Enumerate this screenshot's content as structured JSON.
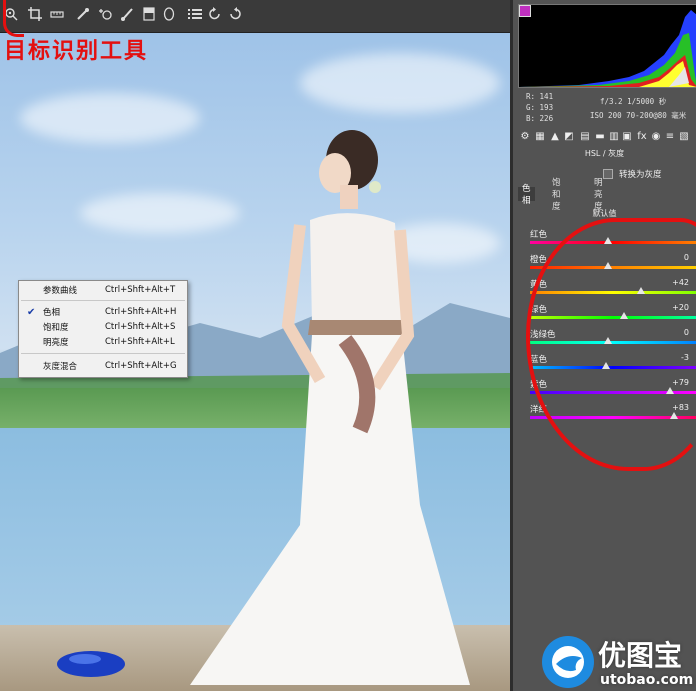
{
  "toolbar": {
    "tools": [
      "target-adjust-icon",
      "crop-icon",
      "straighten-icon",
      "spot-removal-icon",
      "red-eye-icon",
      "brush-icon",
      "graduated-filter-icon",
      "radial-filter-icon",
      "list-icon",
      "rotate-ccw-icon",
      "rotate-cw-icon"
    ]
  },
  "annotation": {
    "title": "目标识别工具"
  },
  "context_menu": {
    "items": [
      {
        "label": "参数曲线",
        "shortcut": "Ctrl+Shft+Alt+T",
        "checked": false
      },
      {
        "label": "色相",
        "shortcut": "Ctrl+Shft+Alt+H",
        "checked": true
      },
      {
        "label": "饱和度",
        "shortcut": "Ctrl+Shft+Alt+S",
        "checked": false
      },
      {
        "label": "明亮度",
        "shortcut": "Ctrl+Shft+Alt+L",
        "checked": false
      },
      {
        "label": "灰度混合",
        "shortcut": "Ctrl+Shft+Alt+G",
        "checked": false
      }
    ]
  },
  "readout": {
    "r": "R:  141",
    "g": "G:  193",
    "b": "B:  226",
    "exposure": "f/3.2   1/5000 秒",
    "lens": "ISO 200   70-200@80 毫米"
  },
  "panel": {
    "section_title": "HSL / 灰度",
    "convert_checkbox": "转换为灰度",
    "tabs": [
      "色相",
      "饱和度",
      "明亮度"
    ],
    "default_label": "默认值",
    "sliders": [
      {
        "label": "红色",
        "value": "",
        "pos": 0.0
      },
      {
        "label": "橙色",
        "value": "0",
        "pos": 0.0
      },
      {
        "label": "黄色",
        "value": "+42",
        "pos": 0.42
      },
      {
        "label": "绿色",
        "value": "+20",
        "pos": 0.2
      },
      {
        "label": "浅绿色",
        "value": "0",
        "pos": 0.0
      },
      {
        "label": "蓝色",
        "value": "-3",
        "pos": -0.03
      },
      {
        "label": "紫色",
        "value": "+79",
        "pos": 0.79
      },
      {
        "label": "洋红",
        "value": "+83",
        "pos": 0.83
      }
    ]
  },
  "watermark": {
    "brand": "优图宝",
    "url": "utobao.com"
  },
  "colors": {
    "annotation_red": "#e31010",
    "panel_bg": "#535353"
  }
}
